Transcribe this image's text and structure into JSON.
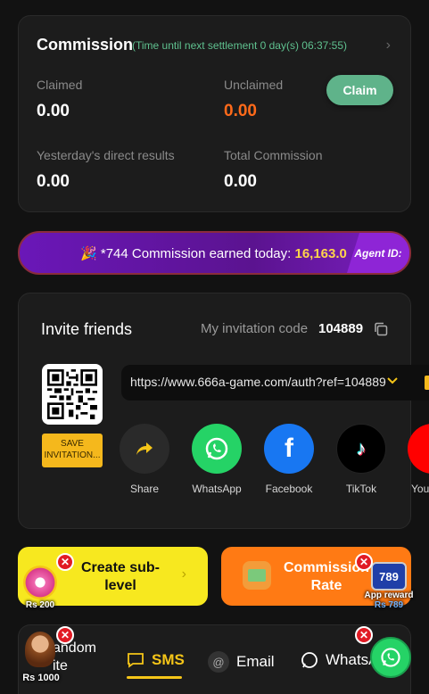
{
  "commission": {
    "title": "Commission",
    "timer": "(Time until next settlement 0 day(s) 06:37:55)",
    "claimed_label": "Claimed",
    "claimed_value": "0.00",
    "unclaimed_label": "Unclaimed",
    "unclaimed_value": "0.00",
    "claim_button": "Claim",
    "yesterday_label": "Yesterday's direct results",
    "yesterday_value": "0.00",
    "total_label": "Total Commission",
    "total_value": "0.00"
  },
  "ticker": {
    "prefix": "*744 Commission earned today:",
    "amount": "16,163.0",
    "agent_label": "Agent ID:"
  },
  "invite": {
    "title": "Invite friends",
    "code_label": "My invitation code",
    "code": "104889",
    "save_button": "SAVE INVITATION...",
    "link": "https://www.666a-game.com/auth?ref=104889",
    "share_items": [
      {
        "label": "Share",
        "color": "#2a2a2a"
      },
      {
        "label": "WhatsApp",
        "color": "#25d366"
      },
      {
        "label": "Facebook",
        "color": "#1877f2"
      },
      {
        "label": "TikTok",
        "color": "#000000"
      },
      {
        "label": "You",
        "color": "#ff0000"
      }
    ]
  },
  "promos": {
    "sublevel": "Create sub-level",
    "rate": "Commission Rate",
    "left_float_caption": "Rs 200",
    "right_float_caption": "App reward",
    "right_float_subcaption": "Rs 789",
    "right_float_brand": "789"
  },
  "tabbar": {
    "random_line1": "andom",
    "random_line2": "ite",
    "random_caption": "Rs 1000",
    "sms": "SMS",
    "email": "Email",
    "whatsapp": "WhatsA"
  },
  "colors": {
    "accent_green": "#5fb38a",
    "unclaimed_orange": "#ff6a1a",
    "ticker_amount": "#ffd54a",
    "tab_underline": "#f5c518"
  }
}
